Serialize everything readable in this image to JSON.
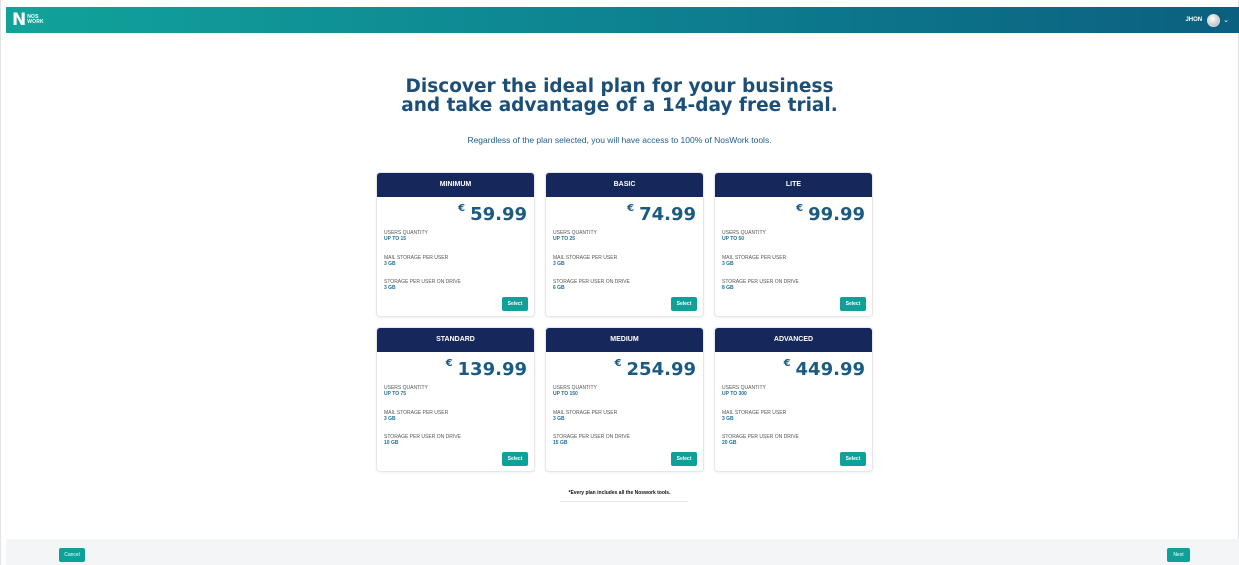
{
  "header": {
    "logo_line1": "NOS",
    "logo_line2": "WORK",
    "logo_letter": "N",
    "user_name": "JHON"
  },
  "hero": {
    "title_line1": "Discover the ideal plan for your business",
    "title_line2": "and take advantage of a 14-day free trial.",
    "subtitle": "Regardless of the plan selected, you will have access to 100% of NosWork tools."
  },
  "labels": {
    "users": "USERS QUANTITY",
    "mail": "MAIL STORAGE PER USER",
    "drive": "STORAGE PER USER ON DRIVE",
    "select": "Select",
    "currency": "€"
  },
  "plans": [
    {
      "name": "MINIMUM",
      "price": "59.99",
      "users": "UP TO 15",
      "mail": "3 GB",
      "drive": "3 GB"
    },
    {
      "name": "BASIC",
      "price": "74.99",
      "users": "UP TO 25",
      "mail": "3 GB",
      "drive": "6 GB"
    },
    {
      "name": "LITE",
      "price": "99.99",
      "users": "UP TO 50",
      "mail": "3 GB",
      "drive": "8 GB"
    },
    {
      "name": "STANDARD",
      "price": "139.99",
      "users": "UP TO 75",
      "mail": "3 GB",
      "drive": "10 GB"
    },
    {
      "name": "MEDIUM",
      "price": "254.99",
      "users": "UP TO 150",
      "mail": "3 GB",
      "drive": "15 GB"
    },
    {
      "name": "ADVANCED",
      "price": "449.99",
      "users": "UP TO 300",
      "mail": "3 GB",
      "drive": "20 GB"
    }
  ],
  "footnote": "*Every plan includes all the Noswork tools.",
  "footer": {
    "cancel_label": "Cancel",
    "next_label": "Next"
  },
  "colors": {
    "accent": "#0fa099",
    "card_header": "#15275b",
    "title": "#1b4f7a"
  }
}
